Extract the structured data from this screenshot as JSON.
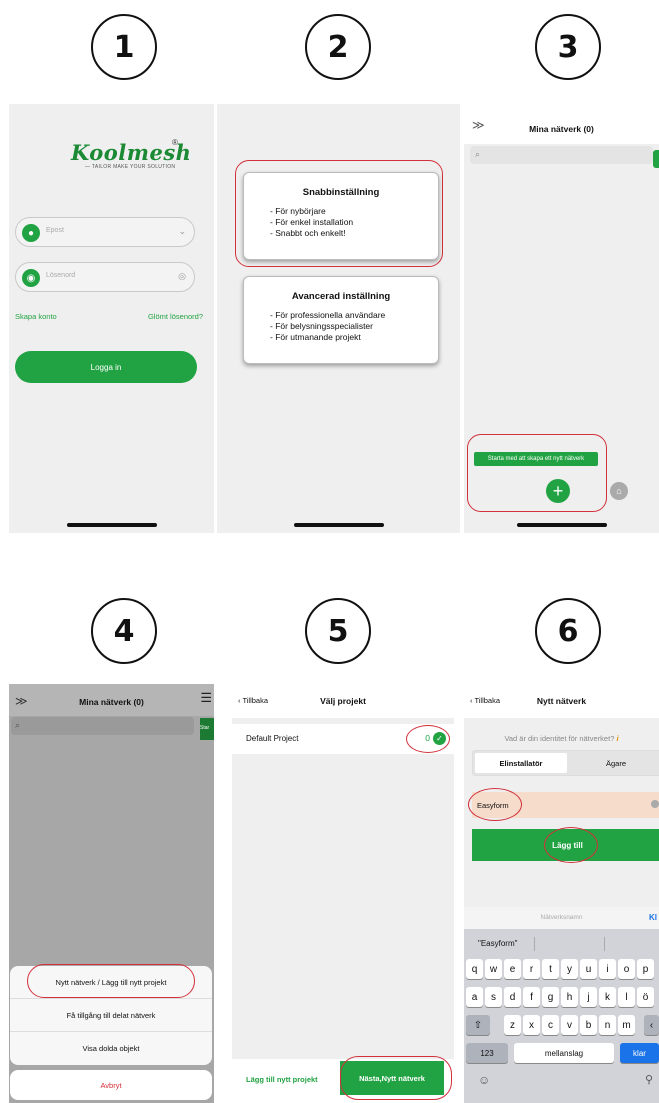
{
  "steps": [
    "1",
    "2",
    "3",
    "4",
    "5",
    "6"
  ],
  "screen1": {
    "logo": "Koolmesh",
    "logo_reg": "®",
    "logo_tagline": "— TAILOR MAKE YOUR SOLUTION",
    "email_placeholder": "Epost",
    "password_placeholder": "Lösenord",
    "create_account": "Skapa konto",
    "forgot_password": "Glömt lösenord?",
    "login_button": "Logga in"
  },
  "screen2": {
    "quick_title": "Snabbinställning",
    "quick_items": [
      "- För nybörjare",
      "- För enkel installation",
      "- Snabbt och enkelt!"
    ],
    "advanced_title": "Avancerad inställning",
    "advanced_items": [
      "- För professionella användare",
      "- För belysningsspecialister",
      "- För utmanande projekt"
    ]
  },
  "screen3": {
    "title": "Mina nätverk (0)",
    "tooltip": "Starta med att skapa ett nytt nätverk"
  },
  "screen4": {
    "title": "Mina nätverk (0)",
    "side_label": "Star",
    "sheet_items": [
      "Nytt nätverk / Lägg till nytt projekt",
      "Få tillgång till delat nätverk",
      "Visa dolda objekt"
    ],
    "cancel": "Avbryt"
  },
  "screen5": {
    "back": "Tillbaka",
    "title": "Välj projekt",
    "project_name": "Default Project",
    "project_count": "0",
    "add_project": "Lägg till nytt projekt",
    "next": "Nästa,Nytt nätverk"
  },
  "screen6": {
    "back": "Tillbaka",
    "title": "Nytt nätverk",
    "question": "Vad är din identitet för nätverket?",
    "tab_installer": "Elinstallatör",
    "tab_owner": "Ägare",
    "input_value": "Easyform",
    "add_button": "Lägg till",
    "kb_hint": "Nätverksnamn",
    "kb_right": "Kl",
    "suggestion": "\"Easyform\"",
    "row1": [
      "q",
      "w",
      "e",
      "r",
      "t",
      "y",
      "u",
      "i",
      "o",
      "p"
    ],
    "row2": [
      "a",
      "s",
      "d",
      "f",
      "g",
      "h",
      "j",
      "k",
      "l",
      "ö"
    ],
    "row3": [
      "z",
      "x",
      "c",
      "v",
      "b",
      "n",
      "m"
    ],
    "key_123": "123",
    "key_space": "mellanslag",
    "key_return": "klar"
  },
  "colors": {
    "accent": "#22a343",
    "highlight": "#d2303a"
  }
}
